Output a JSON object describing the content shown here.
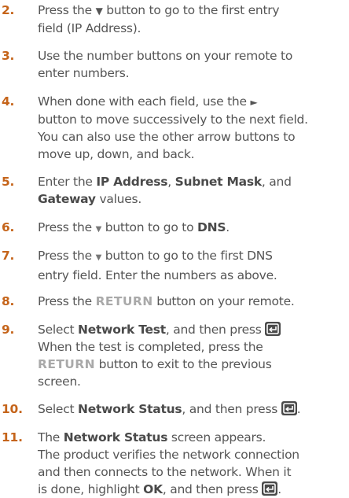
{
  "steps": [
    {
      "num": "2.",
      "l1a": "Press the ",
      "icon": "▼",
      "l1b": " button to go to the first entry",
      "l2": "field (IP Address)."
    },
    {
      "num": "3.",
      "l1": "Use the number buttons on your remote to",
      "l2": "enter numbers."
    },
    {
      "num": "4.",
      "l1a": "When done with each field, use the ",
      "icon": "►",
      "l2": "button to move successively to the next field.",
      "l3": "You can also use the other arrow buttons to",
      "l4": "move up, down, and back."
    },
    {
      "num": "5.",
      "l1a": "Enter the ",
      "b1": "IP Address",
      "l1b": ", ",
      "b2": "Subnet Mask",
      "l1c": ", and",
      "b3": "Gateway",
      "l2b": " values."
    },
    {
      "num": "6.",
      "l1a": "Press the ",
      "icon": "▼",
      "l1b": " button to go to ",
      "b1": "DNS",
      "l1c": "."
    },
    {
      "num": "7.",
      "l1a": "Press the ",
      "icon": "▼",
      "l1b": " button to go to the first DNS",
      "l2": "entry field. Enter the numbers as above."
    },
    {
      "num": "8.",
      "l1a": "Press the ",
      "k1": "RETURN",
      "l1b": " button on your remote."
    },
    {
      "num": "9.",
      "l1a": "Select ",
      "b1": "Network Test",
      "l1b": ", and then press ",
      "l2": "When the test is completed, press the",
      "k1": "RETURN",
      "l3b": "  button to exit to the previous",
      "l4": "screen."
    },
    {
      "num": "10.",
      "l1a": "Select ",
      "b1": "Network Status",
      "l1b": ", and then press ",
      "l1c": "."
    },
    {
      "num": "11.",
      "l1a": "The ",
      "b1": "Network Status",
      "l1b": " screen appears.",
      "l2": "The product verifies the network connection",
      "l3": "and then connects to the network. When it",
      "l4a": "is done, highlight ",
      "b2": "OK",
      "l4b": ", and then press ",
      "l4c": "."
    }
  ]
}
